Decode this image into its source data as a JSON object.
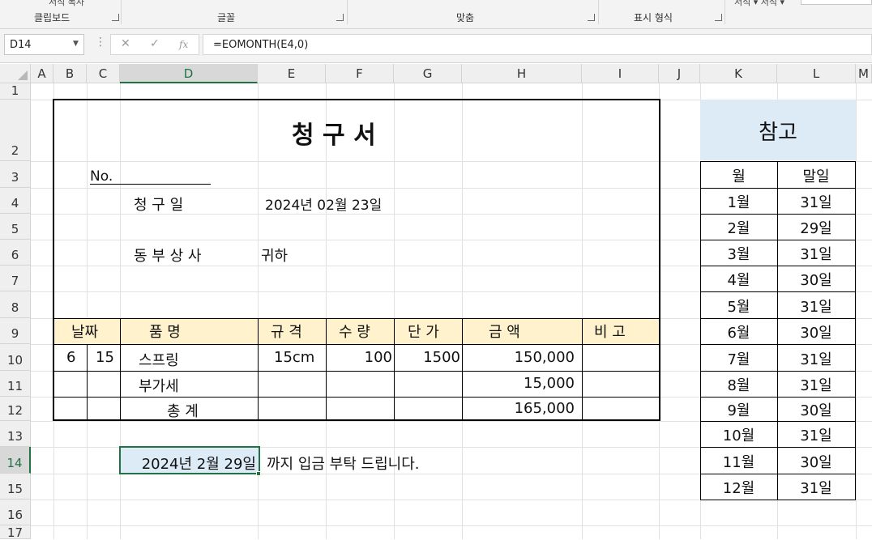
{
  "ribbon": {
    "groups": [
      "클립보드",
      "글꼴",
      "맞춤",
      "표시 형식"
    ],
    "top_fragments": [
      "서식 복사",
      "서식 ▾  서식 ▾"
    ]
  },
  "formula_bar": {
    "name_box": "D14",
    "formula": "=EOMONTH(E4,0)",
    "icons": [
      "cancel-icon",
      "enter-icon",
      "function-icon"
    ]
  },
  "columns": [
    "A",
    "B",
    "C",
    "D",
    "E",
    "F",
    "G",
    "H",
    "I",
    "J",
    "K",
    "L",
    "M"
  ],
  "rows": [
    "1",
    "2",
    "3",
    "4",
    "5",
    "6",
    "7",
    "8",
    "9",
    "10",
    "11",
    "12",
    "13",
    "14",
    "15",
    "16",
    "17"
  ],
  "invoice": {
    "title": "청 구 서",
    "no_label": "No.",
    "date_label": "청 구 일",
    "date_value": "2024년 02월 23일",
    "company": "동 부 상 사",
    "honorific": "귀하",
    "headers": {
      "date": "날짜",
      "item": "품          명",
      "spec": "규 격",
      "qty": "수 량",
      "price": "단 가",
      "amount": "금          액",
      "note": "비     고"
    },
    "line_item": {
      "month": "6",
      "day": "15",
      "item": "스프링",
      "spec": "15cm",
      "qty": "100",
      "price": "1500",
      "amount": "150,000"
    },
    "vat": {
      "label": "부가세",
      "amount": "15,000"
    },
    "total": {
      "label": "총    계",
      "amount": "165,000"
    },
    "due_date": "2024년 2월 29일",
    "due_message": "까지 입금 부탁 드립니다."
  },
  "reference": {
    "title": "참고",
    "headers": [
      "월",
      "말일"
    ],
    "rows": [
      [
        "1월",
        "31일"
      ],
      [
        "2월",
        "29일"
      ],
      [
        "3월",
        "31일"
      ],
      [
        "4월",
        "30일"
      ],
      [
        "5월",
        "31일"
      ],
      [
        "6월",
        "30일"
      ],
      [
        "7월",
        "31일"
      ],
      [
        "8월",
        "31일"
      ],
      [
        "9월",
        "30일"
      ],
      [
        "10월",
        "31일"
      ],
      [
        "11월",
        "30일"
      ],
      [
        "12월",
        "31일"
      ]
    ]
  },
  "colors": {
    "accent": "#217346",
    "reference_fill": "#ddebf7",
    "header_fill": "#fff2cc",
    "selection_fill": "#ddebf7"
  }
}
